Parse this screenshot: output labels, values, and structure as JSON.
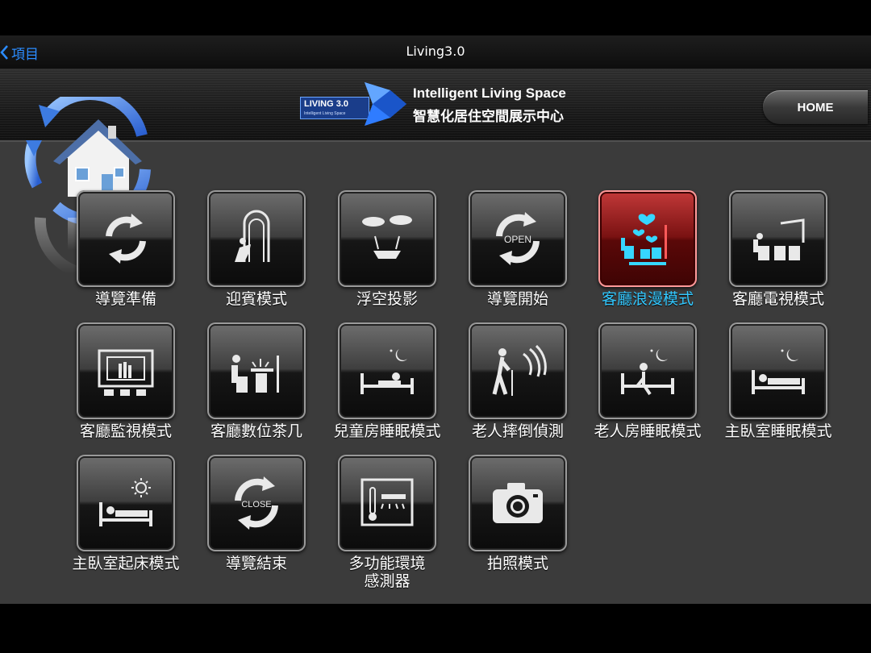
{
  "navbar": {
    "back_label": "項目",
    "title": "Living3.0"
  },
  "header": {
    "logo_box_title": "LIVING 3.0",
    "logo_box_subtitle": "Intelligent Living Space",
    "logo_title_en": "Intelligent Living Space",
    "logo_title_zh": "智慧化居住空間展示中心",
    "home_label": "HOME"
  },
  "tiles": [
    {
      "label": "導覽準備",
      "icon": "cycle-arrows-icon",
      "active": false
    },
    {
      "label": "迎賓模式",
      "icon": "welcome-door-icon",
      "active": false
    },
    {
      "label": "浮空投影",
      "icon": "hologram-projection-icon",
      "active": false
    },
    {
      "label": "導覽開始",
      "icon": "open-cycle-icon",
      "icon_text": "OPEN",
      "active": false
    },
    {
      "label": "客廳浪漫模式",
      "icon": "romance-hearts-icon",
      "active": true
    },
    {
      "label": "客廳電視模式",
      "icon": "tv-watching-icon",
      "active": false
    },
    {
      "label": "客廳監視模式",
      "icon": "surveillance-monitor-icon",
      "active": false
    },
    {
      "label": "客廳數位茶几",
      "icon": "digital-tea-table-icon",
      "active": false
    },
    {
      "label": "兒童房睡眠模式",
      "icon": "child-bed-moon-icon",
      "active": false
    },
    {
      "label": "老人摔倒偵測",
      "icon": "elder-fall-detect-icon",
      "active": false
    },
    {
      "label": "老人房睡眠模式",
      "icon": "elder-bed-moon-icon",
      "active": false
    },
    {
      "label": "主臥室睡眠模式",
      "icon": "bed-moon-icon",
      "active": false
    },
    {
      "label": "主臥室起床模式",
      "icon": "bed-sun-icon",
      "active": false
    },
    {
      "label": "導覽結束",
      "icon": "close-cycle-icon",
      "icon_text": "CLOSE",
      "active": false
    },
    {
      "label": "多功能環境\n感測器",
      "label_line1": "多功能環境",
      "label_line2": "感測器",
      "icon": "environment-sensor-icon",
      "active": false
    },
    {
      "label": "拍照模式",
      "icon": "camera-icon",
      "active": false
    }
  ],
  "colors": {
    "ios_blue": "#2b8cff",
    "active_label": "#33c8ff",
    "active_tile": "#7a1212",
    "background": "#3b3b3b"
  }
}
